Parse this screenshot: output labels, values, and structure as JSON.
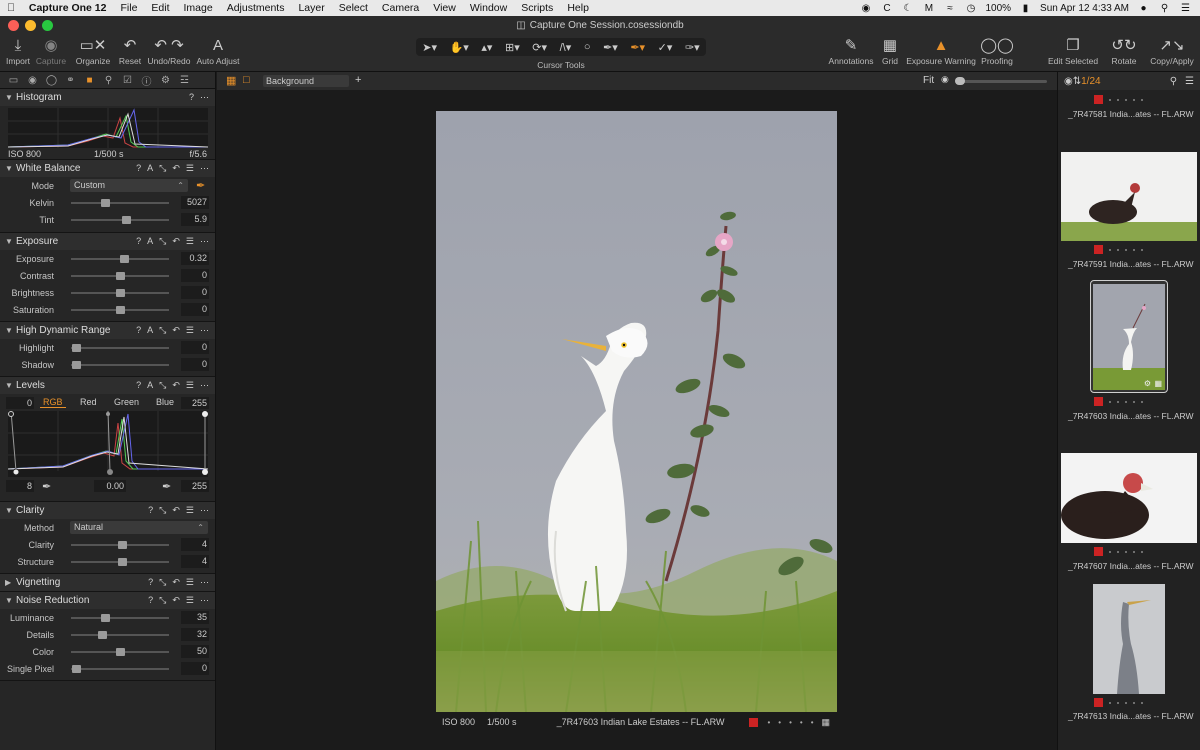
{
  "menubar": {
    "app": "Capture One 12",
    "items": [
      "File",
      "Edit",
      "Image",
      "Adjustments",
      "Layer",
      "Select",
      "Camera",
      "View",
      "Window",
      "Scripts",
      "Help"
    ],
    "battery": "100%",
    "datetime": "Sun Apr 12  4:33 AM"
  },
  "window": {
    "title": "Capture One Session.cosessiondb"
  },
  "toolbar": {
    "import": "Import",
    "capture": "Capture",
    "organize": "Organize",
    "reset": "Reset",
    "undo_redo": "Undo/Redo",
    "auto_adjust": "Auto Adjust",
    "cursor_tools": "Cursor Tools",
    "annotations": "Annotations",
    "grid": "Grid",
    "exposure_warning": "Exposure Warning",
    "proofing": "Proofing",
    "edit_selected": "Edit Selected",
    "rotate": "Rotate",
    "copy_apply": "Copy/Apply"
  },
  "histogram": {
    "title": "Histogram",
    "iso": "ISO 800",
    "shutter": "1/500 s",
    "aperture": "f/5.6"
  },
  "white_balance": {
    "title": "White Balance",
    "mode_label": "Mode",
    "mode_value": "Custom",
    "kelvin_label": "Kelvin",
    "kelvin_value": "5027",
    "kelvin_pos": 0.35,
    "tint_label": "Tint",
    "tint_value": "5.9",
    "tint_pos": 0.56
  },
  "exposure": {
    "title": "Exposure",
    "rows": [
      {
        "label": "Exposure",
        "value": "0.32",
        "pos": 0.54
      },
      {
        "label": "Contrast",
        "value": "0",
        "pos": 0.5
      },
      {
        "label": "Brightness",
        "value": "0",
        "pos": 0.5
      },
      {
        "label": "Saturation",
        "value": "0",
        "pos": 0.5
      }
    ]
  },
  "hdr": {
    "title": "High Dynamic Range",
    "rows": [
      {
        "label": "Highlight",
        "value": "0",
        "pos": 0.05
      },
      {
        "label": "Shadow",
        "value": "0",
        "pos": 0.05
      }
    ]
  },
  "levels": {
    "title": "Levels",
    "low": "0",
    "high": "255",
    "tabs": [
      "RGB",
      "Red",
      "Green",
      "Blue"
    ],
    "out_low": "8",
    "mid": "0.00",
    "out_high": "255"
  },
  "clarity": {
    "title": "Clarity",
    "method_label": "Method",
    "method_value": "Natural",
    "rows": [
      {
        "label": "Clarity",
        "value": "4",
        "pos": 0.52
      },
      {
        "label": "Structure",
        "value": "4",
        "pos": 0.52
      }
    ]
  },
  "vignetting": {
    "title": "Vignetting"
  },
  "noise": {
    "title": "Noise Reduction",
    "rows": [
      {
        "label": "Luminance",
        "value": "35",
        "pos": 0.35
      },
      {
        "label": "Details",
        "value": "32",
        "pos": 0.32
      },
      {
        "label": "Color",
        "value": "50",
        "pos": 0.5
      },
      {
        "label": "Single Pixel",
        "value": "0",
        "pos": 0.05
      }
    ]
  },
  "viewer": {
    "background": "Background",
    "zoom": "Fit",
    "iso": "ISO 800",
    "shutter": "1/500 s",
    "filename": "_7R47603 Indian Lake Estates -- FL.ARW"
  },
  "browser": {
    "count": "1/24",
    "thumbs": [
      "_7R47581 India...ates -- FL.ARW",
      "_7R47591 India...ates -- FL.ARW",
      "_7R47603 India...ates -- FL.ARW",
      "_7R47607 India...ates -- FL.ARW",
      "_7R47613 India...ates -- FL.ARW"
    ]
  },
  "colors": {
    "accent": "#e8912a",
    "rating_red": "#cc2323",
    "panel": "#262626",
    "viewer_bg": "#1b1b1b"
  }
}
